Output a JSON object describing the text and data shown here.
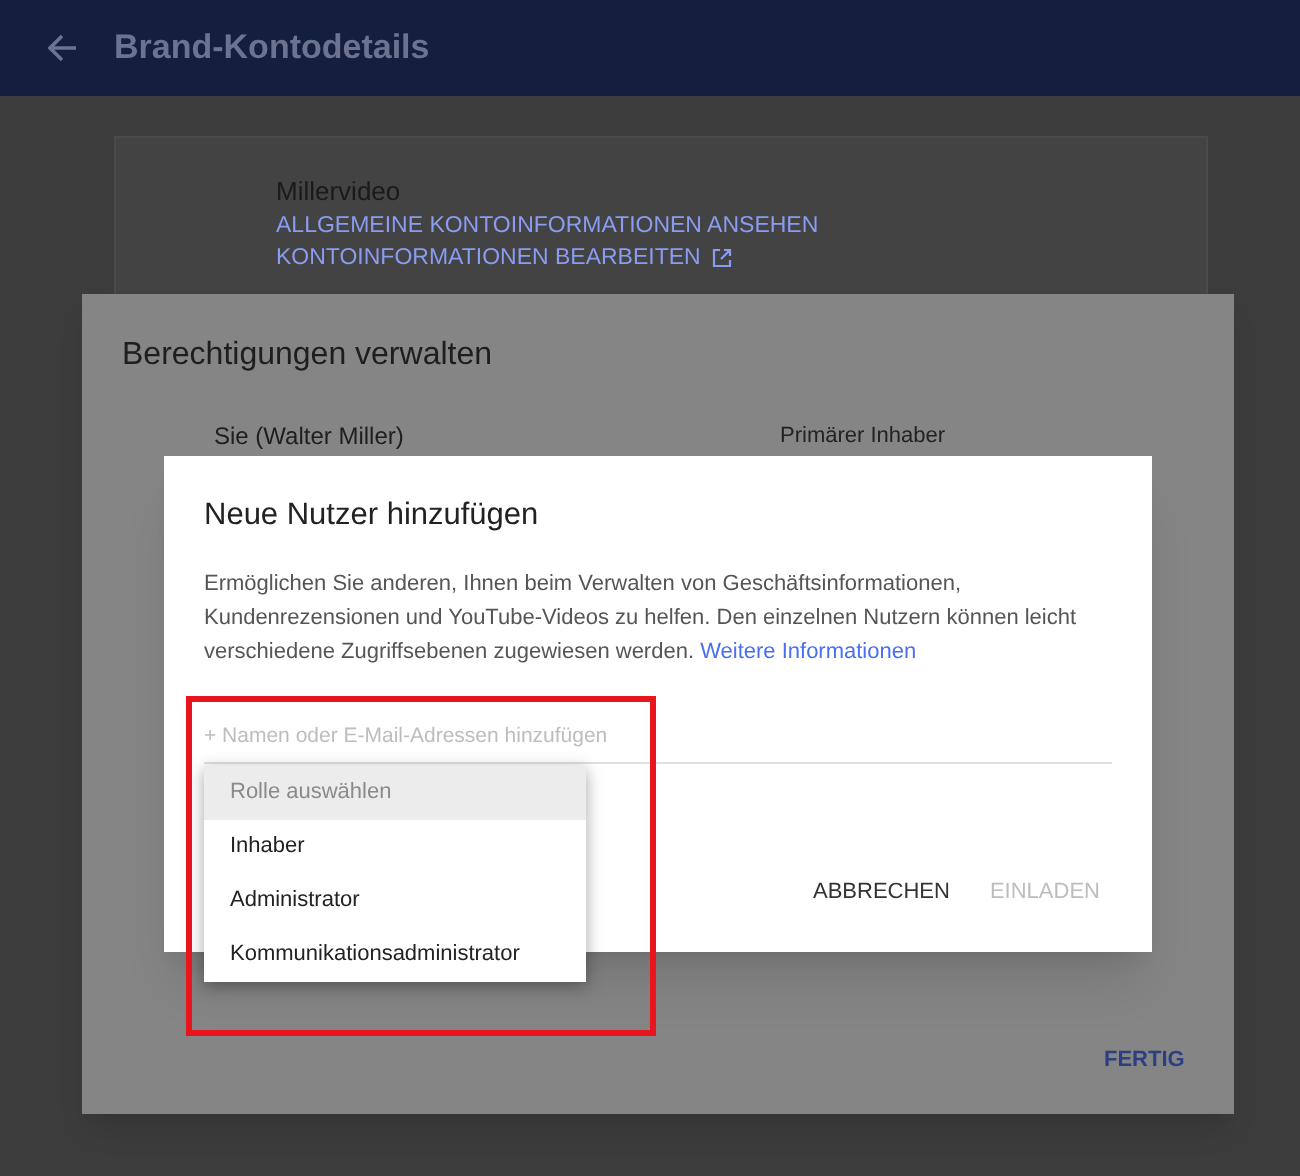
{
  "header": {
    "title": "Brand-Kontodetails"
  },
  "account": {
    "name": "Millervideo",
    "links": [
      "ALLGEMEINE KONTOINFORMATIONEN ANSEHEN",
      "KONTOINFORMATIONEN BEARBEITEN"
    ]
  },
  "permissions_dialog": {
    "title": "Berechtigungen verwalten",
    "user": "Sie (Walter Miller)",
    "role": "Primärer Inhaber",
    "done_button": "FERTIG"
  },
  "add_users_dialog": {
    "title": "Neue Nutzer hinzufügen",
    "description": "Ermöglichen Sie anderen, Ihnen beim Verwalten von Geschäftsinformationen, Kundenrezensionen und YouTube-Videos zu helfen. Den einzelnen Nutzern können leicht verschiedene Zugriffsebenen zugewiesen werden.",
    "link": "Weitere Informationen",
    "input": {
      "placeholder": "+ Namen oder E-Mail-Adressen hinzufügen"
    },
    "buttons": [
      {
        "label": "ABBRECHEN",
        "disabled": false
      },
      {
        "label": "EINLADEN",
        "disabled": true
      }
    ]
  },
  "role_menu": {
    "items": [
      {
        "label": "Rolle auswählen",
        "selected": true
      },
      {
        "label": "Inhaber",
        "selected": false
      },
      {
        "label": "Administrator",
        "selected": false
      },
      {
        "label": "Kommunikationsadministrator",
        "selected": false
      }
    ]
  },
  "highlight": {
    "color": "#e8141e"
  }
}
